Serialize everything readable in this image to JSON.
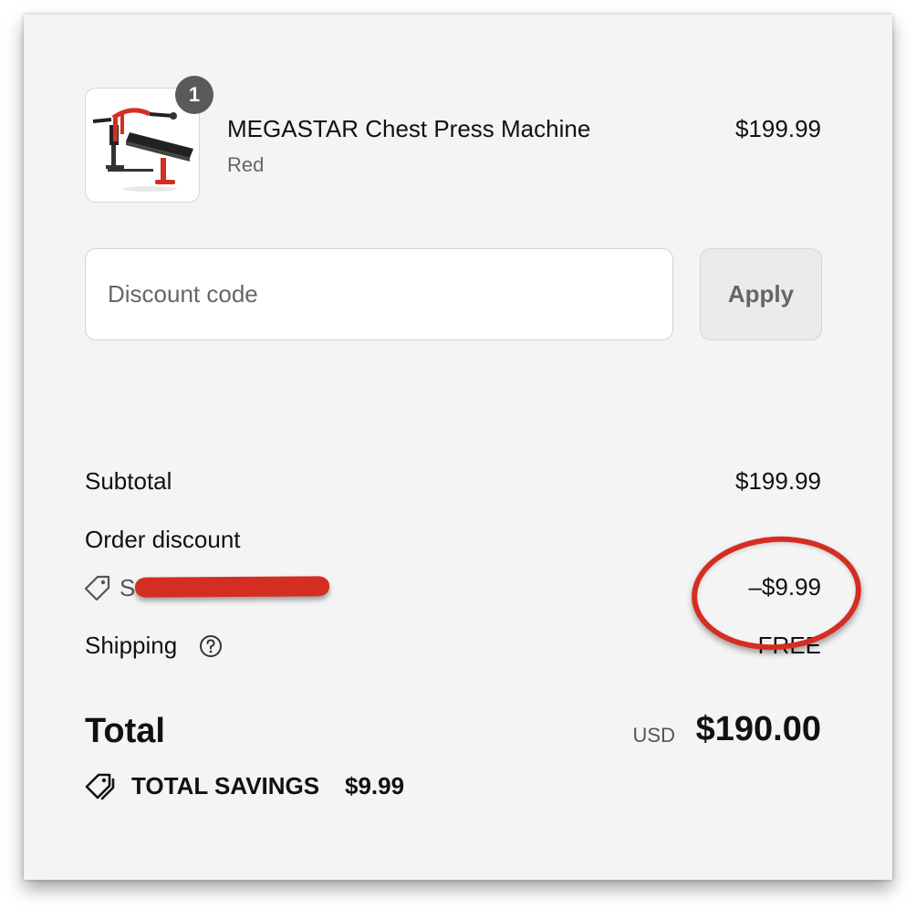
{
  "product": {
    "quantity": "1",
    "name": "MEGASTAR Chest Press Machine",
    "variant": "Red",
    "price": "$199.99",
    "image_icon": "chest-press-machine-image"
  },
  "discount": {
    "placeholder": "Discount code",
    "apply_label": "Apply"
  },
  "summary": {
    "subtotal_label": "Subtotal",
    "subtotal_value": "$199.99",
    "order_discount_label": "Order discount",
    "discount_code_visible": "S",
    "discount_value": "–$9.99",
    "shipping_label": "Shipping",
    "shipping_value": "FREE",
    "total_label": "Total",
    "currency": "USD",
    "total_value": "$190.00",
    "savings_label": "TOTAL SAVINGS",
    "savings_value": "$9.99"
  },
  "colors": {
    "annotation_red": "#d42e22",
    "background": "#f4f4f4"
  }
}
